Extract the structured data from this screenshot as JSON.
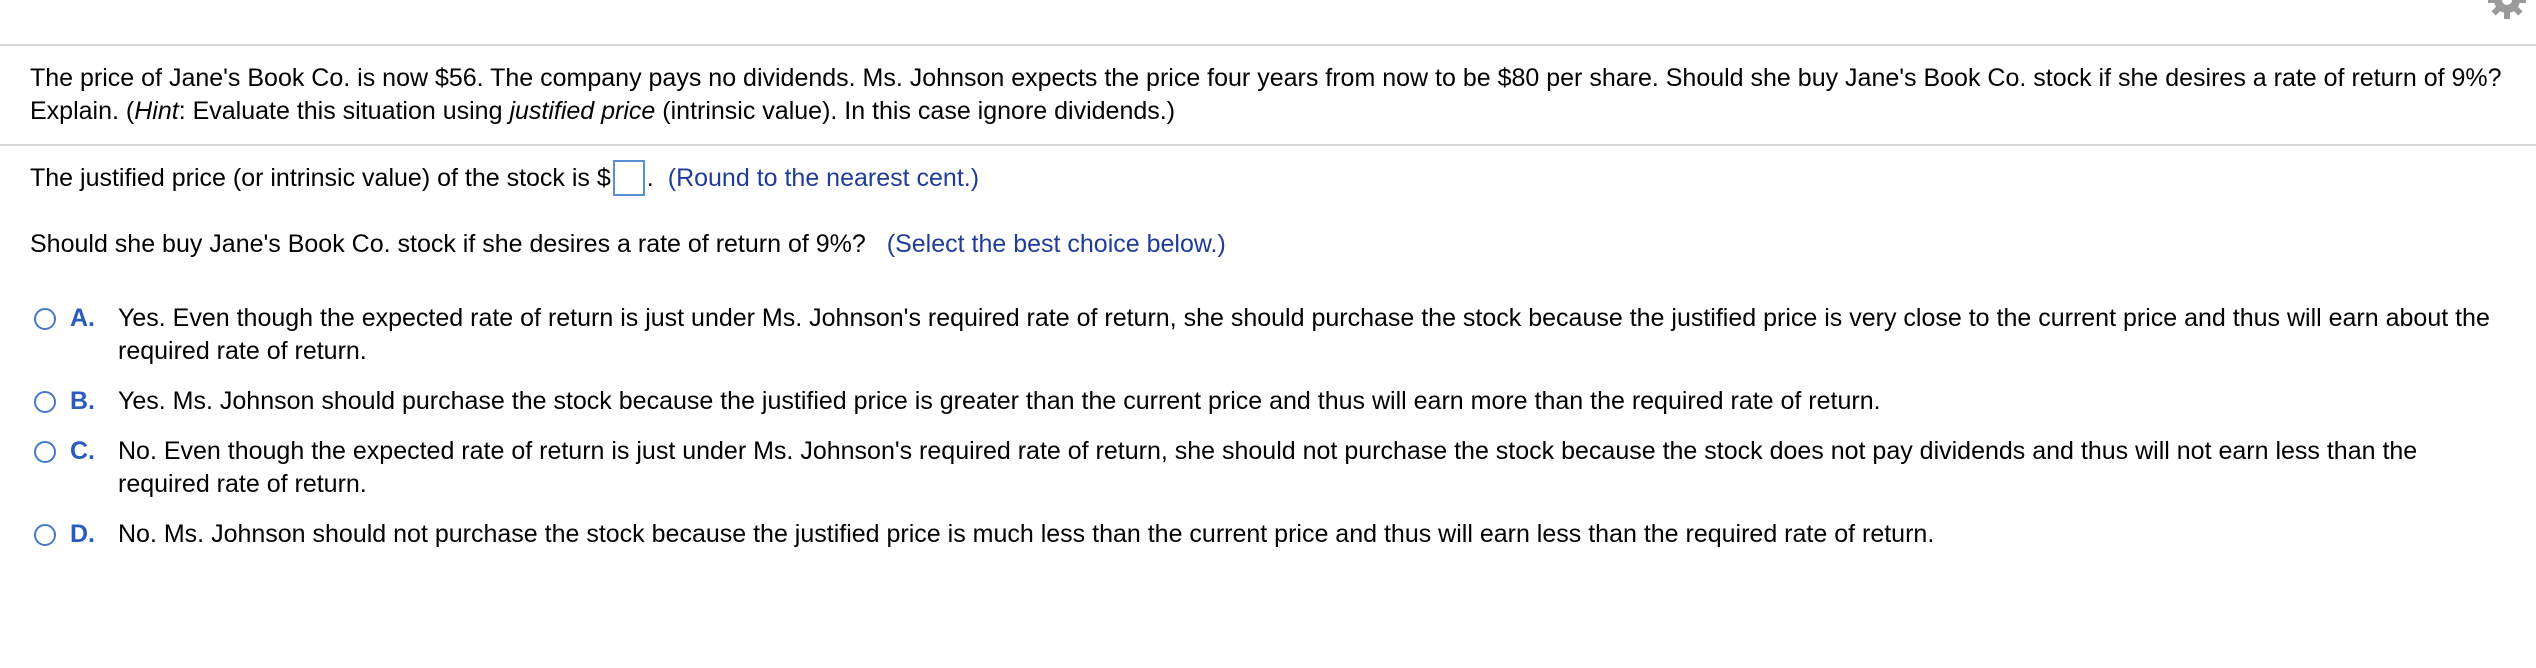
{
  "question": {
    "text_before_hint": "The price of Jane's Book Co. is now $56. The company pays no dividends. Ms. Johnson expects the price four years from now to be $80 per share. Should she buy Jane's Book Co. stock if she desires a rate of return of 9%? Explain. (",
    "hint_label": "Hint",
    "text_mid": ": Evaluate this situation using ",
    "justified_price_italic": "justified price",
    "text_end": " (intrinsic value). In this case ignore dividends.)"
  },
  "part1": {
    "prompt": "The justified price (or intrinsic value) of the stock is $",
    "answer_value": "",
    "after_box": ".",
    "hint": "(Round to the nearest cent.)"
  },
  "part2": {
    "prompt": "Should she buy Jane's Book Co. stock if she desires a rate of return of 9%?",
    "hint": "(Select the best choice below.)"
  },
  "choices": [
    {
      "letter": "A.",
      "text": "Yes. Even though the expected rate of return is just under Ms. Johnson's required rate of return, she should  purchase the stock because the justified price is very close to the current price and thus will earn about the required rate of return."
    },
    {
      "letter": "B.",
      "text": "Yes. Ms. Johnson should purchase the stock because the justified price is greater than the current price and thus will earn more than the required rate of return."
    },
    {
      "letter": "C.",
      "text": "No. Even though the expected rate of return is just under Ms. Johnson's required rate of return, she should not purchase the stock because the stock does not pay dividends and thus will not earn less than the required rate of return."
    },
    {
      "letter": "D.",
      "text": "No. Ms. Johnson should not purchase the stock because the justified price is much less than the current price and thus will earn less than the required rate of return."
    }
  ],
  "colors": {
    "hint_blue": "#1f3c9a",
    "choice_letter_blue": "#2a5cc0",
    "radio_border": "#4a78c8",
    "answer_box_border": "#5a8fd6",
    "divider": "#d6d6d6"
  },
  "icons": {
    "settings": "gear-icon"
  }
}
